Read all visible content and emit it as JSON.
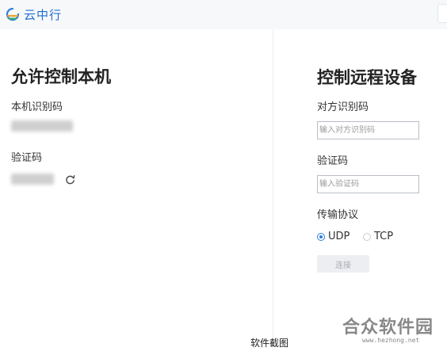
{
  "app": {
    "name": "云中行",
    "icon": "cloud-logo-icon",
    "brand_color": "#1f6fd1"
  },
  "left_panel": {
    "title": "允许控制本机",
    "device_id_label": "本机识别码",
    "device_id_value": "",
    "verify_code_label": "验证码",
    "verify_code_value": "",
    "refresh_icon": "refresh-icon"
  },
  "right_panel": {
    "title": "控制远程设备",
    "partner_id_label": "对方识别码",
    "partner_id_placeholder": "输入对方识别码",
    "verify_code_label": "验证码",
    "verify_code_placeholder": "输入验证码",
    "protocol_label": "传输协议",
    "protocols": [
      {
        "label": "UDP",
        "selected": true
      },
      {
        "label": "TCP",
        "selected": false
      }
    ],
    "connect_label": "连接"
  },
  "watermark": {
    "logo_text": "合众软件园",
    "url": "www.hezhong.net"
  },
  "caption": "软件截图",
  "colors": {
    "accent": "#2f7de1",
    "disabled_button": "#eceef1"
  }
}
